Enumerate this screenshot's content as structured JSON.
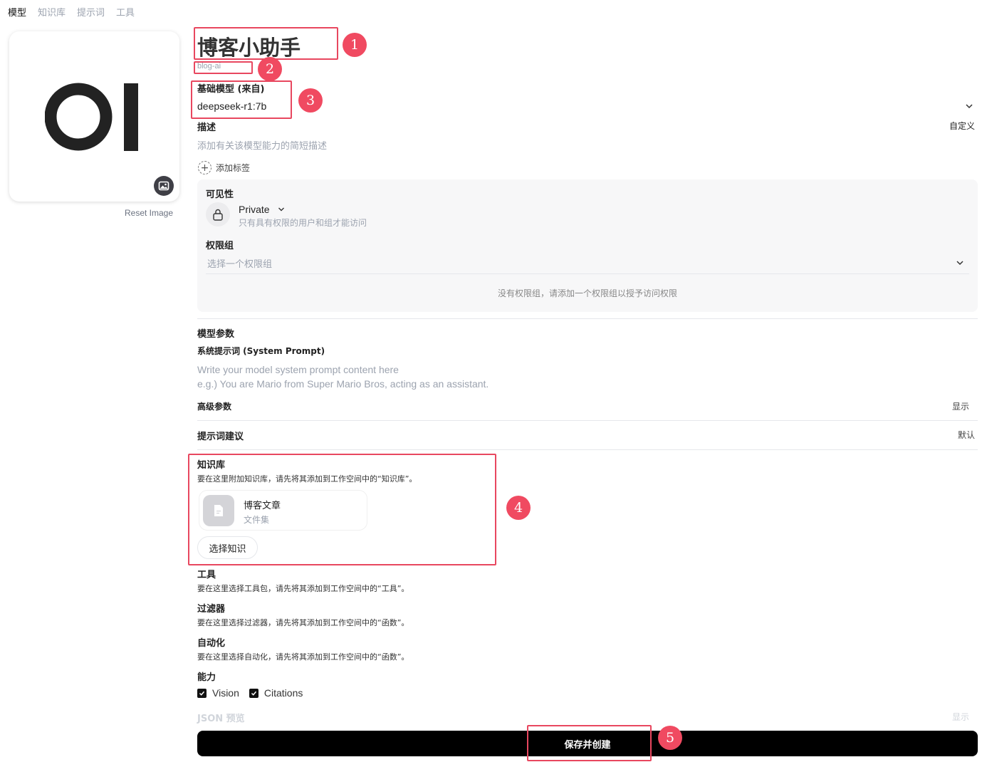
{
  "tabs": [
    {
      "label": "模型",
      "active": true
    },
    {
      "label": "知识库",
      "active": false
    },
    {
      "label": "提示词",
      "active": false
    },
    {
      "label": "工具",
      "active": false
    }
  ],
  "avatar": {
    "logo_text": "OI",
    "reset_label": "Reset Image",
    "icon": "image-icon"
  },
  "model": {
    "name": "博客小助手",
    "id": "blog-ai",
    "base_model_label": "基础模型 (来自)",
    "base_model_value": "deepseek-r1:7b"
  },
  "description": {
    "label": "描述",
    "toggle": "自定义",
    "placeholder": "添加有关该模型能力的简短描述"
  },
  "tags": {
    "add_label": "添加标签"
  },
  "visibility": {
    "label": "可见性",
    "value": "Private",
    "desc": "只有具有权限的用户和组才能访问",
    "group_label": "权限组",
    "group_placeholder": "选择一个权限组",
    "empty_text": "没有权限组，请添加一个权限组以授予访问权限"
  },
  "params": {
    "label": "模型参数",
    "system_prompt_label": "系统提示词 (System Prompt)",
    "system_prompt_placeholder_1": "Write your model system prompt content here",
    "system_prompt_placeholder_2": "e.g.) You are Mario from Super Mario Bros, acting as an assistant.",
    "advanced_label": "高级参数",
    "advanced_toggle": "显示"
  },
  "suggestions": {
    "label": "提示词建议",
    "toggle": "默认"
  },
  "knowledge": {
    "label": "知识库",
    "desc": "要在这里附加知识库，请先将其添加到工作空间中的“知识库”。",
    "items": [
      {
        "name": "博客文章",
        "type": "文件集"
      }
    ],
    "select_button": "选择知识"
  },
  "tools": {
    "label": "工具",
    "desc": "要在这里选择工具包，请先将其添加到工作空间中的“工具”。"
  },
  "filters": {
    "label": "过滤器",
    "desc": "要在这里选择过滤器，请先将其添加到工作空间中的“函数”。"
  },
  "actions": {
    "label": "自动化",
    "desc": "要在这里选择自动化，请先将其添加到工作空间中的“函数”。"
  },
  "capabilities": {
    "label": "能力",
    "items": [
      {
        "name": "Vision",
        "checked": true
      },
      {
        "name": "Citations",
        "checked": true
      }
    ]
  },
  "json_preview": {
    "label": "JSON 预览",
    "toggle": "显示"
  },
  "save_button": "保存并创建",
  "annotations": [
    "1",
    "2",
    "3",
    "4",
    "5"
  ],
  "colors": {
    "annotation": "#e8475f",
    "primary_button": "#000000",
    "panel_bg": "#f7f7f8"
  }
}
